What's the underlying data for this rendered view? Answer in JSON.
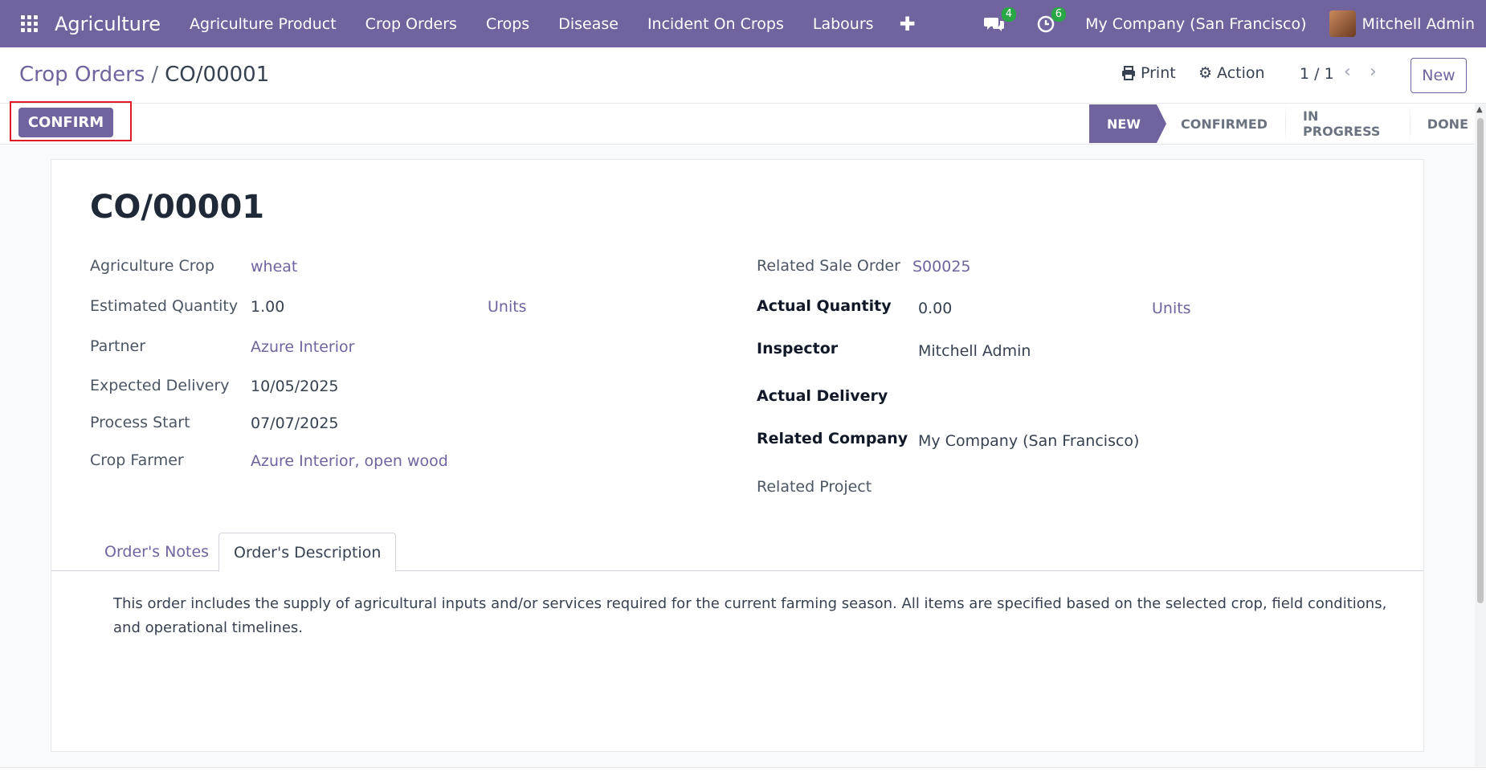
{
  "nav": {
    "app_name": "Agriculture",
    "menu": [
      "Agriculture Product",
      "Crop Orders",
      "Crops",
      "Disease",
      "Incident On Crops",
      "Labours"
    ],
    "messages_count": "4",
    "activities_count": "6",
    "company": "My Company (San Francisco)",
    "user": "Mitchell Admin"
  },
  "control": {
    "breadcrumb_parent": "Crop Orders",
    "breadcrumb_separator": "/",
    "breadcrumb_current": "CO/00001",
    "print_label": "Print",
    "action_label": "Action",
    "pager": "1 / 1",
    "new_label": "New"
  },
  "statusbar": {
    "confirm_label": "CONFIRM",
    "stages": [
      "NEW",
      "CONFIRMED",
      "IN PROGRESS",
      "DONE"
    ],
    "active_stage": "NEW"
  },
  "record": {
    "title": "CO/00001",
    "left_fields": {
      "crop_label": "Agriculture Crop",
      "crop_value": "wheat",
      "est_qty_label": "Estimated Quantity",
      "est_qty_value": "1.00",
      "est_qty_uom": "Units",
      "partner_label": "Partner",
      "partner_value": "Azure Interior",
      "expected_delivery_label": "Expected Delivery",
      "expected_delivery_value": "10/05/2025",
      "process_start_label": "Process Start",
      "process_start_value": "07/07/2025",
      "farmer_label": "Crop Farmer",
      "farmer_value": "Azure Interior, open wood"
    },
    "right_fields": {
      "sale_order_label": "Related Sale Order",
      "sale_order_value": "S00025",
      "actual_qty_label": "Actual Quantity",
      "actual_qty_value": "0.00",
      "actual_qty_uom": "Units",
      "inspector_label": "Inspector",
      "inspector_value": "Mitchell Admin",
      "actual_delivery_label": "Actual Delivery",
      "company_label": "Related Company",
      "company_value": "My Company (San Francisco)",
      "project_label": "Related Project"
    },
    "tabs": [
      "Order's Notes",
      "Order's Description"
    ],
    "active_tab": "Order's Description",
    "description_line1": "This order includes the supply of agricultural inputs and/or services required for the current farming season. All items are specified based on the selected crop, field conditions,",
    "description_line2": "and operational timelines."
  },
  "colors": {
    "brand": "#71639e",
    "badge": "#28a745",
    "highlight": "#e01b24"
  }
}
